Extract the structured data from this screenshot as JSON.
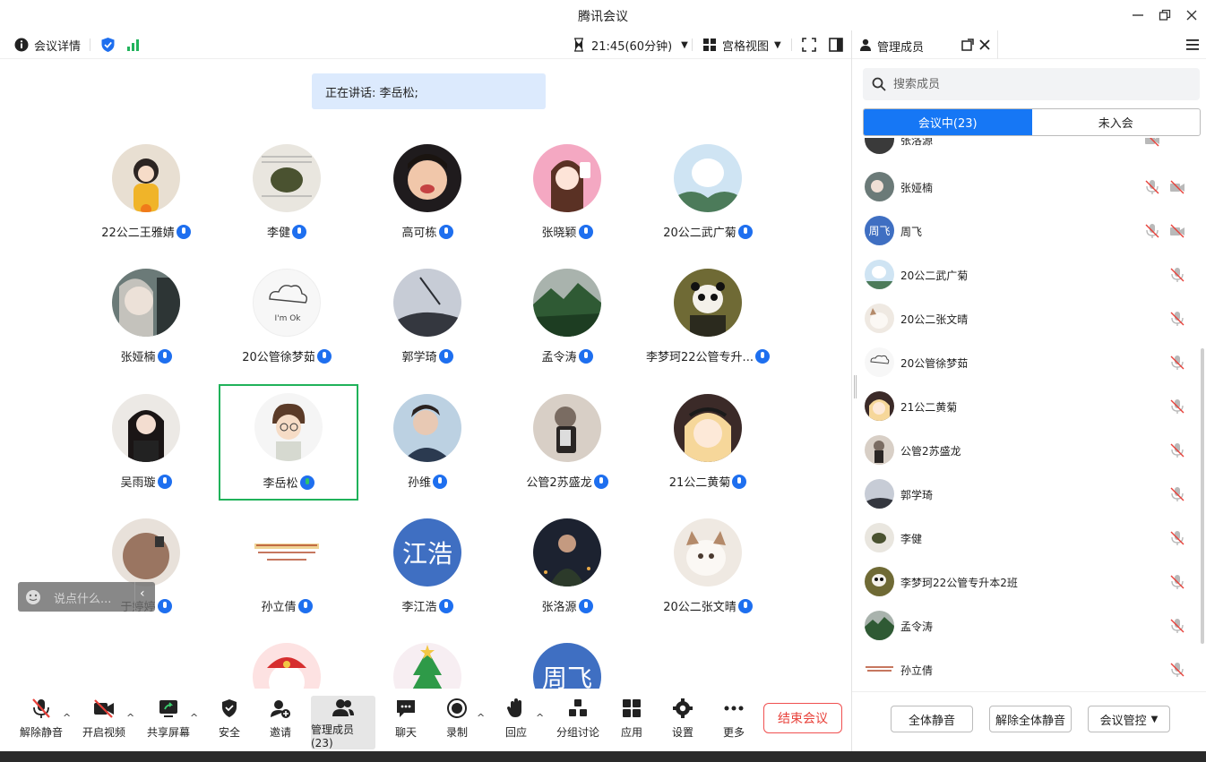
{
  "window": {
    "title": "腾讯会议"
  },
  "toolbar": {
    "info": "会议详情",
    "timer": "21:45(60分钟)",
    "view": "宫格视图"
  },
  "speaking": {
    "label": "正在讲话: 李岳松;"
  },
  "tiles": [
    {
      "name": "22公二王雅婧"
    },
    {
      "name": "李健"
    },
    {
      "name": "高可栋"
    },
    {
      "name": "张晓颖"
    },
    {
      "name": "20公二武广菊"
    },
    {
      "name": "张娅楠"
    },
    {
      "name": "20公管徐梦茹",
      "avatar_text": "I'm Ok"
    },
    {
      "name": "郭学琦"
    },
    {
      "name": "孟令涛"
    },
    {
      "name": "李梦珂22公管专升..."
    },
    {
      "name": "吴雨璇"
    },
    {
      "name": "李岳松"
    },
    {
      "name": "孙维"
    },
    {
      "name": "公管2苏盛龙"
    },
    {
      "name": "21公二黄菊"
    },
    {
      "name": "于婷婷"
    },
    {
      "name": "孙立倩"
    },
    {
      "name": "李江浩",
      "avatar_text": "江浩"
    },
    {
      "name": "张洛源"
    },
    {
      "name": "20公二张文晴"
    },
    {
      "name": ""
    },
    {
      "name": ""
    },
    {
      "name": "",
      "avatar_text": "周飞"
    }
  ],
  "chat": {
    "placeholder": "说点什么..."
  },
  "bottom": {
    "unmute": "解除静音",
    "video": "开启视频",
    "share": "共享屏幕",
    "security": "安全",
    "invite": "邀请",
    "members": "管理成员(23)",
    "chat": "聊天",
    "record": "录制",
    "reply": "回应",
    "breakout": "分组讨论",
    "apps": "应用",
    "settings": "设置",
    "more": "更多",
    "end": "结束会议"
  },
  "panel": {
    "title": "管理成员",
    "search_placeholder": "搜索成员",
    "tab_in": "会议中(23)",
    "tab_out": "未入会",
    "members": [
      {
        "name": "张洛源",
        "cam": true
      },
      {
        "name": "张娅楠",
        "cam": true
      },
      {
        "name": "周飞",
        "avatar_text": "周飞",
        "cam": true
      },
      {
        "name": "20公二武广菊"
      },
      {
        "name": "20公二张文晴"
      },
      {
        "name": "20公管徐梦茹"
      },
      {
        "name": "21公二黄菊"
      },
      {
        "name": "公管2苏盛龙"
      },
      {
        "name": "郭学琦"
      },
      {
        "name": "李健"
      },
      {
        "name": "李梦珂22公管专升本2班"
      },
      {
        "name": "孟令涛"
      },
      {
        "name": "孙立倩"
      }
    ],
    "mute_all": "全体静音",
    "unmute_all": "解除全体静音",
    "control": "会议管控"
  },
  "colors": {
    "accent": "#1677f5",
    "end": "#e8413a",
    "speaking_bg": "#dceafd",
    "active_border": "#20b25a"
  }
}
